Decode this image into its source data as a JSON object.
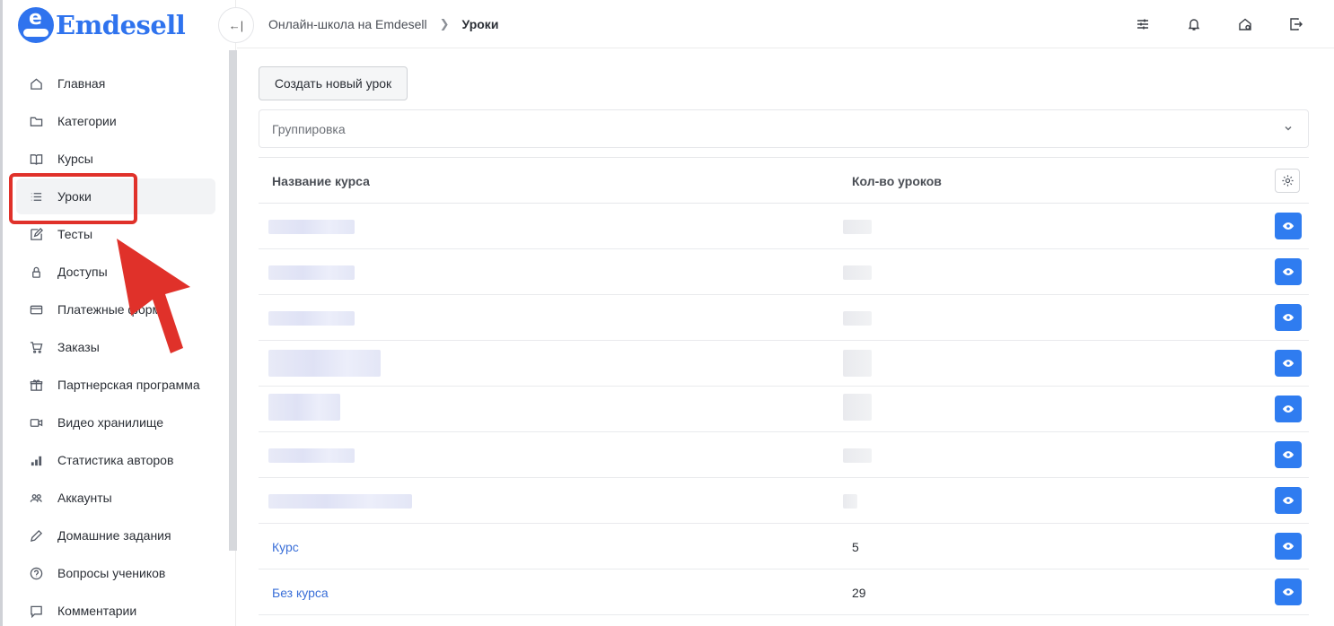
{
  "app": {
    "logo_text": "Emdesell"
  },
  "sidebar": {
    "items": [
      {
        "label": "Главная",
        "icon": "home-icon",
        "active": false
      },
      {
        "label": "Категории",
        "icon": "folder-icon",
        "active": false
      },
      {
        "label": "Курсы",
        "icon": "book-icon",
        "active": false
      },
      {
        "label": "Уроки",
        "icon": "list-icon",
        "active": true
      },
      {
        "label": "Тесты",
        "icon": "edit-icon",
        "active": false
      },
      {
        "label": "Доступы",
        "icon": "lock-icon",
        "active": false
      },
      {
        "label": "Платежные формы",
        "icon": "card-icon",
        "active": false
      },
      {
        "label": "Заказы",
        "icon": "cart-icon",
        "active": false
      },
      {
        "label": "Партнерская программа",
        "icon": "gift-icon",
        "active": false
      },
      {
        "label": "Видео хранилище",
        "icon": "video-icon",
        "active": false
      },
      {
        "label": "Статистика авторов",
        "icon": "bar-chart-icon",
        "active": false
      },
      {
        "label": "Аккаунты",
        "icon": "users-icon",
        "active": false
      },
      {
        "label": "Домашние задания",
        "icon": "pen-icon",
        "active": false
      },
      {
        "label": "Вопросы учеников",
        "icon": "question-icon",
        "active": false
      },
      {
        "label": "Комментарии",
        "icon": "comment-icon",
        "active": false
      }
    ]
  },
  "header": {
    "breadcrumb": {
      "parent": "Онлайн-школа на Emdesell",
      "current": "Уроки"
    },
    "icons": [
      "filter-settings-icon",
      "bell-icon",
      "home-settings-icon",
      "logout-icon"
    ]
  },
  "main": {
    "create_button": "Создать новый урок",
    "grouping_placeholder": "Группировка",
    "table": {
      "headers": {
        "name": "Название курса",
        "count": "Кол-во уроков"
      },
      "rows": [
        {
          "name": "",
          "count": "",
          "redacted": true
        },
        {
          "name": "",
          "count": "",
          "redacted": true
        },
        {
          "name": "",
          "count": "",
          "redacted": true
        },
        {
          "name": "",
          "count": "",
          "redacted": true
        },
        {
          "name": "",
          "count": "",
          "redacted": true
        },
        {
          "name": "",
          "count": "",
          "redacted": true
        },
        {
          "name": "",
          "count": "",
          "redacted": true
        },
        {
          "name": "Курс",
          "count": "5",
          "redacted": false
        },
        {
          "name": "Без курса",
          "count": "29",
          "redacted": false
        }
      ]
    }
  },
  "colors": {
    "accent": "#2f7cf0",
    "annotation": "#e0312a",
    "link": "#3a6fd8"
  }
}
